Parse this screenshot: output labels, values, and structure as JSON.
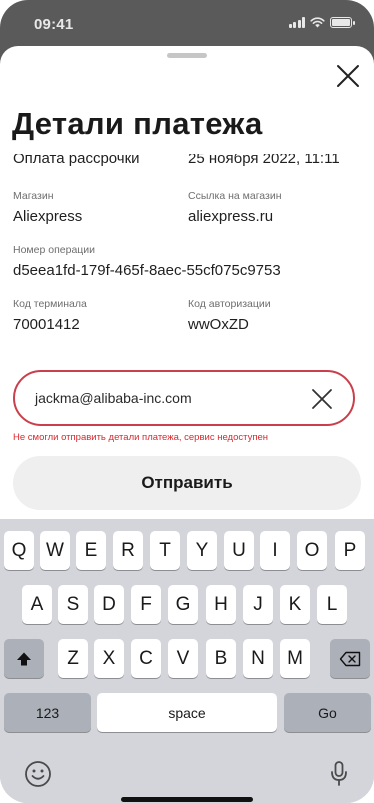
{
  "status_bar": {
    "time": "09:41"
  },
  "sheet": {
    "title": "Детали платежа",
    "clipped_row": {
      "left": "Оплата рассрочки",
      "right": "25 ноября 2022, 11:11"
    },
    "fields": {
      "store": {
        "label": "Магазин",
        "value": "Aliexpress"
      },
      "store_link": {
        "label": "Ссылка на магазин",
        "value": "aliexpress.ru"
      },
      "operation": {
        "label": "Номер операции",
        "value": "d5eea1fd-179f-465f-8aec-55cf075c9753"
      },
      "terminal": {
        "label": "Код терминала",
        "value": "70001412"
      },
      "auth": {
        "label": "Код авторизации",
        "value": "wwOxZD"
      }
    },
    "email": {
      "value": "jackma@alibaba-inc.com",
      "error": "Не смогли отправить детали платежа, сервис недоступен"
    },
    "send_label": "Отправить"
  },
  "keyboard": {
    "row1": [
      "Q",
      "W",
      "E",
      "R",
      "T",
      "Y",
      "U",
      "I",
      "O",
      "P"
    ],
    "row2": [
      "A",
      "S",
      "D",
      "F",
      "G",
      "H",
      "J",
      "K",
      "L"
    ],
    "row3": [
      "Z",
      "X",
      "C",
      "V",
      "B",
      "N",
      "M"
    ],
    "numbers_label": "123",
    "space_label": "space",
    "go_label": "Go",
    "shift_icon": "shift-arrow-up",
    "backspace_icon": "backspace",
    "emoji_icon": "emoji",
    "mic_icon": "microphone"
  },
  "colors": {
    "error": "#d8292f",
    "field_border": "#c9404c",
    "keyboard_bg": "#d3d5da"
  }
}
